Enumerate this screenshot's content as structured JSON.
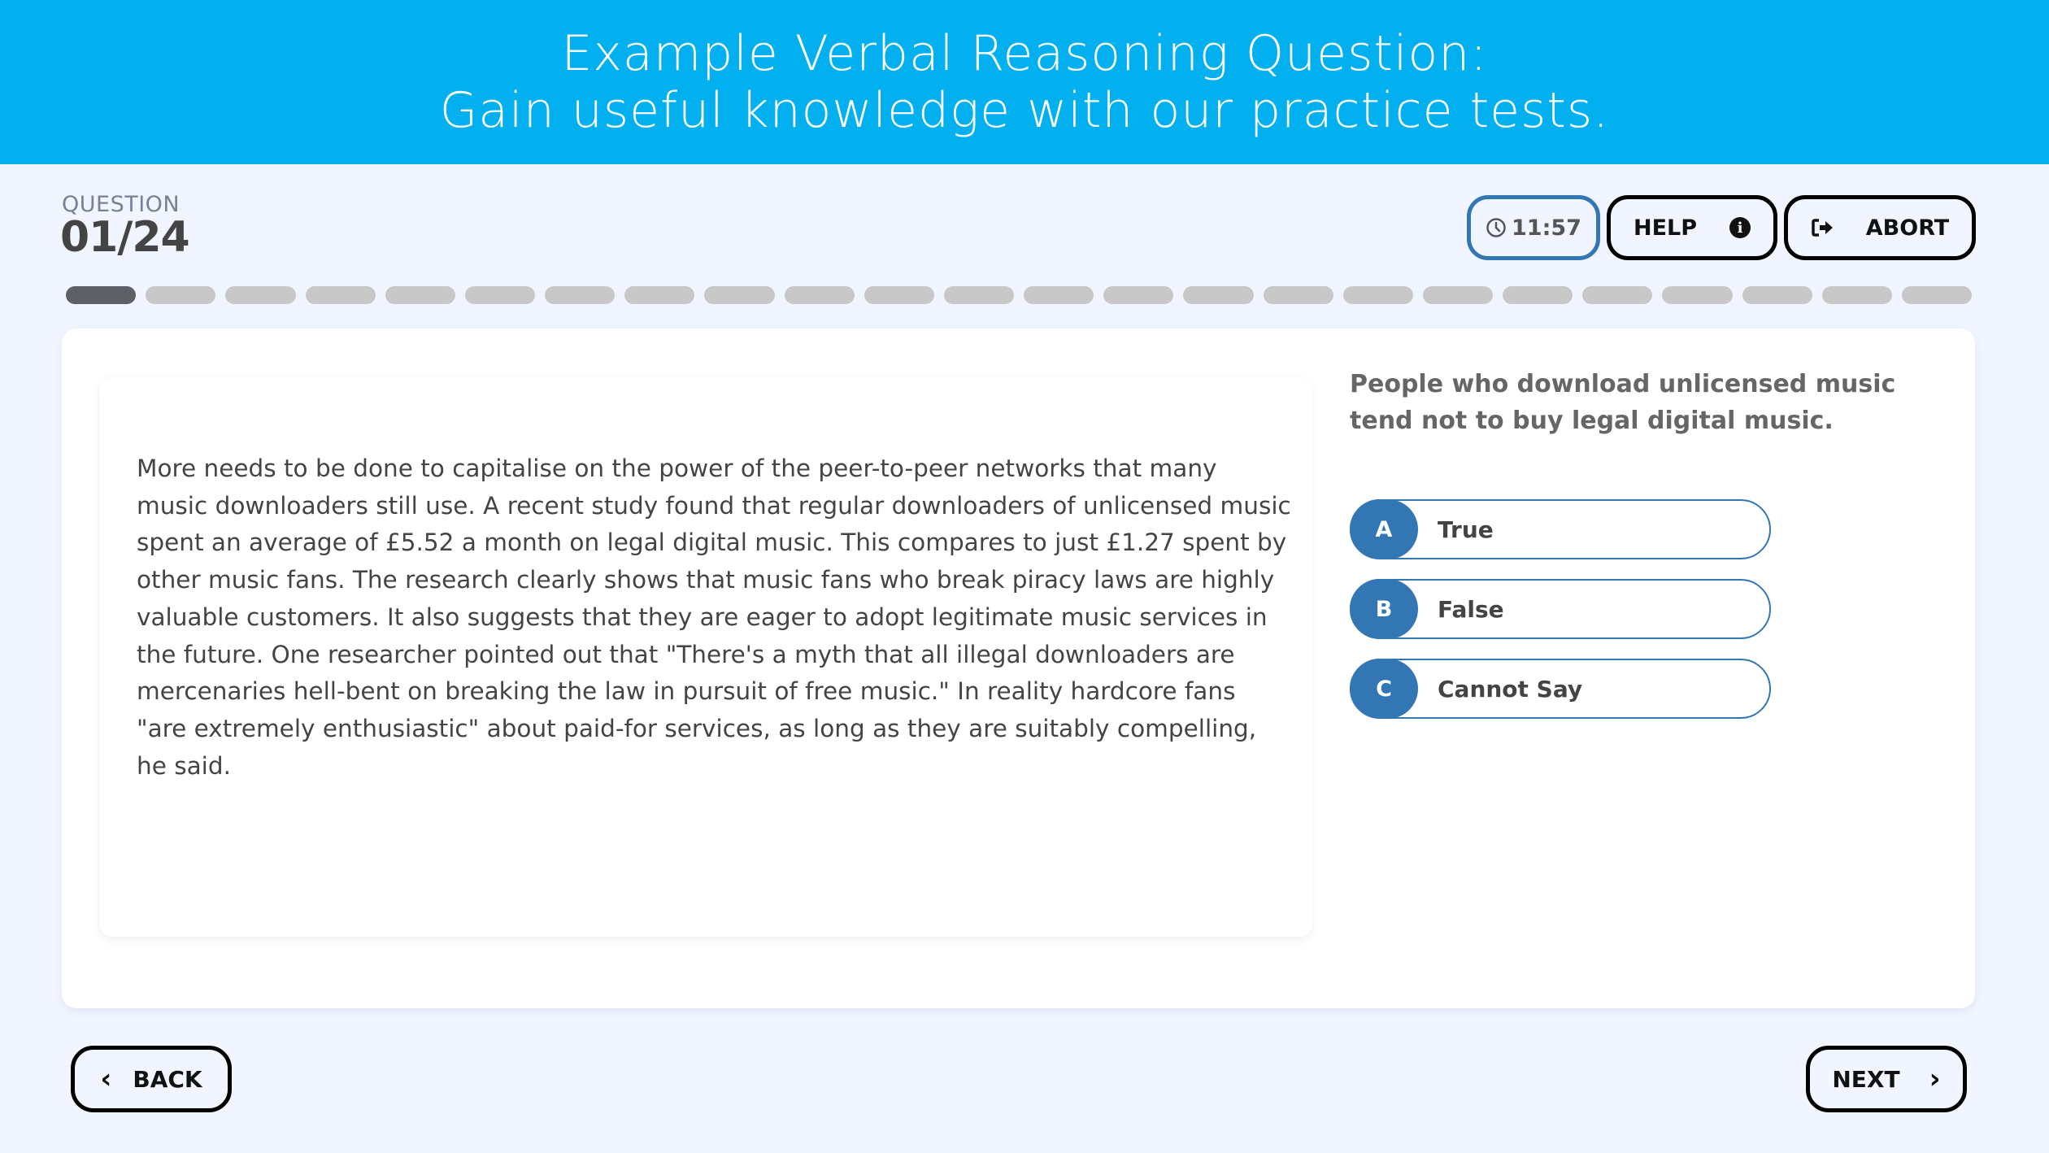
{
  "banner": {
    "line1": "Example Verbal Reasoning Question:",
    "line2": "Gain useful knowledge with our practice tests."
  },
  "question": {
    "label": "QUESTION",
    "number": "01/24",
    "current": 1,
    "total": 24
  },
  "toolbar": {
    "timer": "11:57",
    "timer_icon": "clock-icon",
    "help_label": "HELP",
    "help_icon": "info-icon",
    "abort_label": "ABORT",
    "abort_icon": "sign-out-icon"
  },
  "passage": "More needs to be done to capitalise on the power of the peer-to-peer networks that many music downloaders still use. A recent study found that regular downloaders of unlicensed music spent an average of £5.52 a month on legal digital music. This compares to just £1.27 spent by other music fans. The research clearly shows that music fans who break piracy laws are highly valuable customers. It also suggests that they are eager to adopt legitimate music services in the future. One researcher pointed out that \"There's a myth that all illegal downloaders are mercenaries hell-bent on breaking the law in pursuit of free music.\" In reality hardcore fans \"are extremely enthusiastic\" about paid-for services, as long as they are suitably compelling, he said.",
  "statement": "People who download unlicensed music tend not to buy legal digital music.",
  "options": [
    {
      "letter": "A",
      "label": "True"
    },
    {
      "letter": "B",
      "label": "False"
    },
    {
      "letter": "C",
      "label": "Cannot Say"
    }
  ],
  "nav": {
    "back_label": "BACK",
    "next_label": "NEXT"
  },
  "colors": {
    "banner": "#02b0ef",
    "accent": "#3276b4",
    "background": "#f0f5ff"
  }
}
